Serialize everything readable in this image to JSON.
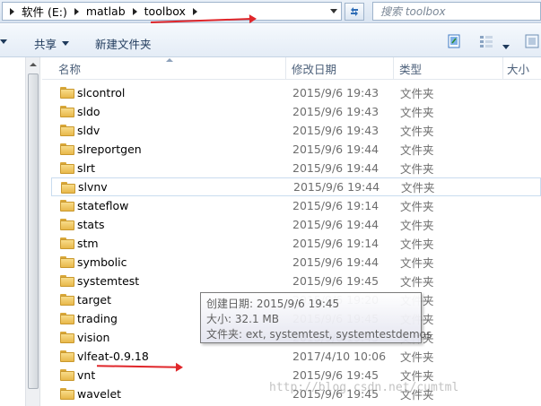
{
  "address_bar": {
    "crumbs": [
      "软件 (E:)",
      "matlab",
      "toolbox"
    ]
  },
  "search": {
    "placeholder": "搜索 toolbox"
  },
  "toolbar": {
    "share_label": "共享",
    "new_folder_label": "新建文件夹"
  },
  "columns": {
    "name": "名称",
    "date": "修改日期",
    "type": "类型",
    "size": "大小"
  },
  "files": [
    {
      "name": "slcontrol",
      "date": "2015/9/6 19:43",
      "type": "文件夹"
    },
    {
      "name": "sldo",
      "date": "2015/9/6 19:43",
      "type": "文件夹"
    },
    {
      "name": "sldv",
      "date": "2015/9/6 19:43",
      "type": "文件夹"
    },
    {
      "name": "slreportgen",
      "date": "2015/9/6 19:44",
      "type": "文件夹"
    },
    {
      "name": "slrt",
      "date": "2015/9/6 19:44",
      "type": "文件夹"
    },
    {
      "name": "slvnv",
      "date": "2015/9/6 19:44",
      "type": "文件夹"
    },
    {
      "name": "stateflow",
      "date": "2015/9/6 19:14",
      "type": "文件夹"
    },
    {
      "name": "stats",
      "date": "2015/9/6 19:44",
      "type": "文件夹"
    },
    {
      "name": "stm",
      "date": "2015/9/6 19:14",
      "type": "文件夹"
    },
    {
      "name": "symbolic",
      "date": "2015/9/6 19:44",
      "type": "文件夹"
    },
    {
      "name": "systemtest",
      "date": "2015/9/6 19:45",
      "type": "文件夹"
    },
    {
      "name": "target",
      "date": "2015/9/6 19:20",
      "type": "文件夹"
    },
    {
      "name": "trading",
      "date": "2015/9/6 19:45",
      "type": "文件夹"
    },
    {
      "name": "vision",
      "date": "2015/9/6 19:45",
      "type": "文件夹"
    },
    {
      "name": "vlfeat-0.9.18",
      "date": "2017/4/10 10:06",
      "type": "文件夹"
    },
    {
      "name": "vnt",
      "date": "2015/9/6 19:45",
      "type": "文件夹"
    },
    {
      "name": "wavelet",
      "date": "2015/9/6 19:45",
      "type": "文件夹"
    }
  ],
  "selected_row": 5,
  "tooltip": {
    "created": "创建日期: 2015/9/6 19:45",
    "size": "大小: 32.1 MB",
    "folders": "文件夹: ext, systemtest, systemtestdemos"
  },
  "watermark": "http://blog.csdn.net/cumtml",
  "colors": {
    "annotation_red": "#e0262a",
    "folder_yellow": "#e8b84a",
    "header_text": "#4c607a"
  },
  "icons": {
    "refresh": "refresh-icon",
    "view_pane": "preview-pane-icon",
    "view_options": "view-options-icon",
    "help": "help-icon"
  }
}
